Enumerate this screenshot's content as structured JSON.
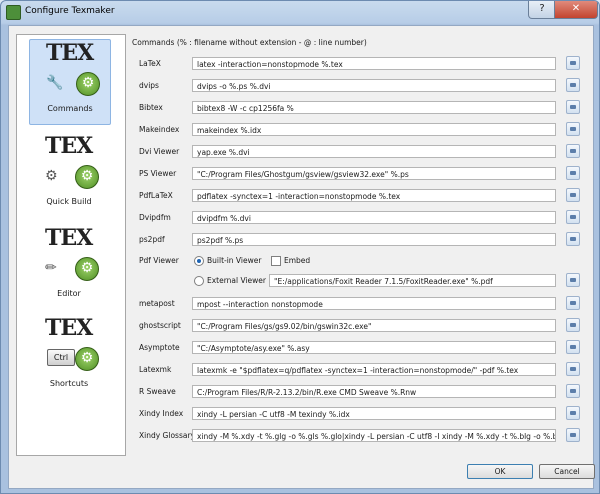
{
  "window": {
    "title": "Configure Texmaker",
    "help_label": "?",
    "close_label": "✕"
  },
  "sidebar": {
    "logo_text": "TEX",
    "items": [
      {
        "label": "Commands",
        "icon": "wrench-icon"
      },
      {
        "label": "Quick Build",
        "icon": "gears-icon"
      },
      {
        "label": "Editor",
        "icon": "pencil-icon"
      },
      {
        "label": "Shortcuts",
        "icon": "ctrl-key-icon",
        "key_label": "Ctrl"
      }
    ]
  },
  "commands": {
    "header": "Commands (% : filename without extension - @ : line number)",
    "rows": [
      {
        "label": "LaTeX",
        "value": "latex -interaction=nonstopmode %.tex"
      },
      {
        "label": "dvips",
        "value": "dvips -o %.ps %.dvi"
      },
      {
        "label": "Bibtex",
        "value": "bibtex8 -W -c cp1256fa %"
      },
      {
        "label": "Makeindex",
        "value": "makeindex %.idx"
      },
      {
        "label": "Dvi Viewer",
        "value": "yap.exe %.dvi"
      },
      {
        "label": "PS Viewer",
        "value": "\"C:/Program Files/Ghostgum/gsview/gsview32.exe\" %.ps"
      },
      {
        "label": "PdfLaTeX",
        "value": "pdflatex -synctex=1 -interaction=nonstopmode %.tex"
      },
      {
        "label": "Dvipdfm",
        "value": "dvipdfm %.dvi"
      },
      {
        "label": "ps2pdf",
        "value": "ps2pdf %.ps"
      }
    ],
    "pdf_viewer": {
      "label": "Pdf Viewer",
      "builtin_label": "Built-in Viewer",
      "embed_label": "Embed",
      "external_label": "External Viewer",
      "external_value": "\"E:/applications/Foxit Reader 7.1.5/FoxitReader.exe\" %.pdf"
    },
    "rows2": [
      {
        "label": "metapost",
        "value": "mpost --interaction nonstopmode"
      },
      {
        "label": "ghostscript",
        "value": "\"C:/Program Files/gs/gs9.02/bin/gswin32c.exe\""
      },
      {
        "label": "Asymptote",
        "value": "\"C:/Asymptote/asy.exe\" %.asy"
      },
      {
        "label": "Latexmk",
        "value": "latexmk -e \"$pdflatex=q/pdflatex -synctex=1 -interaction=nonstopmode/\" -pdf %.tex"
      },
      {
        "label": "R Sweave",
        "value": "C:/Program Files/R/R-2.13.2/bin/R.exe CMD Sweave %.Rnw"
      },
      {
        "label": "Xindy Index",
        "value": "xindy -L persian -C utf8 -M texindy %.idx"
      },
      {
        "label": "Xindy Glossary",
        "value": "xindy -M %.xdy -t %.glg -o %.gls %.glo|xindy -L persian -C utf8 -I xindy -M %.xdy -t %.blg -o %.bls %.blo"
      }
    ]
  },
  "buttons": {
    "ok": "OK",
    "cancel": "Cancel"
  }
}
